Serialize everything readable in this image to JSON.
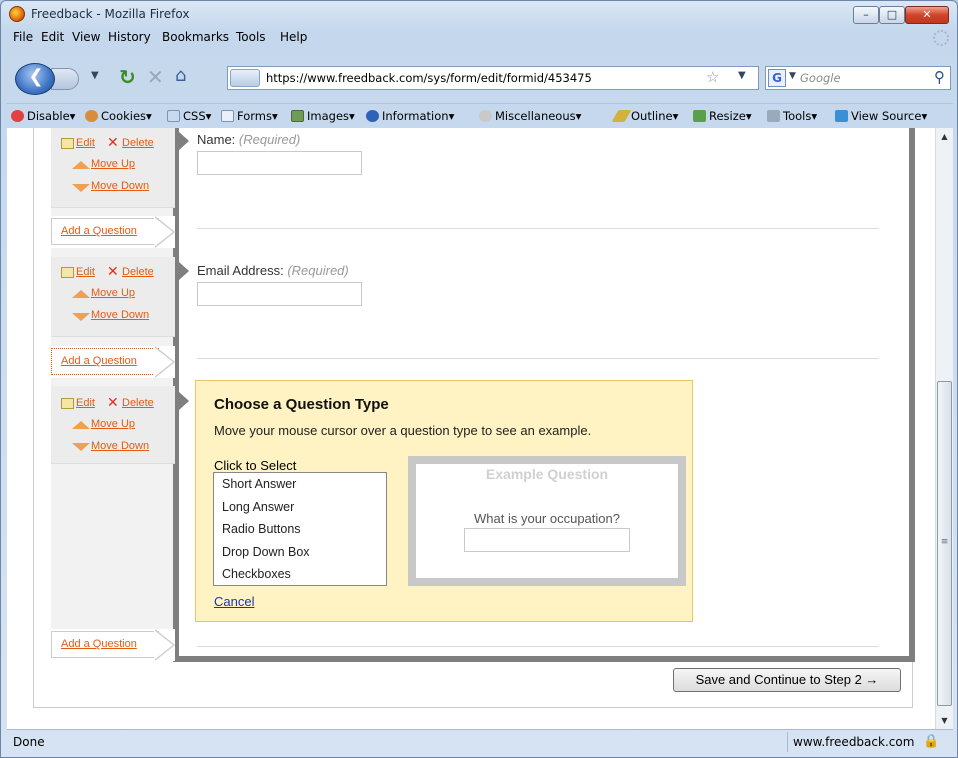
{
  "window": {
    "title": "Freedback - Mozilla Firefox",
    "min": "–",
    "max": "□",
    "close": "✕"
  },
  "menubar": [
    "File",
    "Edit",
    "View",
    "History",
    "Bookmarks",
    "Tools",
    "Help"
  ],
  "nav": {
    "url": "https://www.freedback.com/sys/form/edit/formid/453475",
    "search_placeholder": "Google",
    "search_engine_letter": "G"
  },
  "devtoolbar": [
    "Disable",
    "Cookies",
    "CSS",
    "Forms",
    "Images",
    "Information",
    "Miscellaneous",
    "Outline",
    "Resize",
    "Tools",
    "View Source"
  ],
  "controls": {
    "edit": "Edit",
    "delete": "Delete",
    "move_up": "Move Up",
    "move_down": "Move Down",
    "add_question": "Add a Question"
  },
  "questions": [
    {
      "label": "Name:",
      "required": "(Required)"
    },
    {
      "label": "Email Address:",
      "required": "(Required)"
    }
  ],
  "chooser": {
    "title": "Choose a Question Type",
    "description": "Move your mouse cursor over a question type to see an example.",
    "select_label": "Click to Select",
    "types": [
      "Short Answer",
      "Long Answer",
      "Radio Buttons",
      "Drop Down Box",
      "Checkboxes"
    ],
    "cancel": "Cancel",
    "example_title": "Example Question",
    "example_question": "What is your occupation?"
  },
  "save_button": "Save and Continue to Step 2 →",
  "status": {
    "text": "Done",
    "domain": "www.freedback.com"
  }
}
